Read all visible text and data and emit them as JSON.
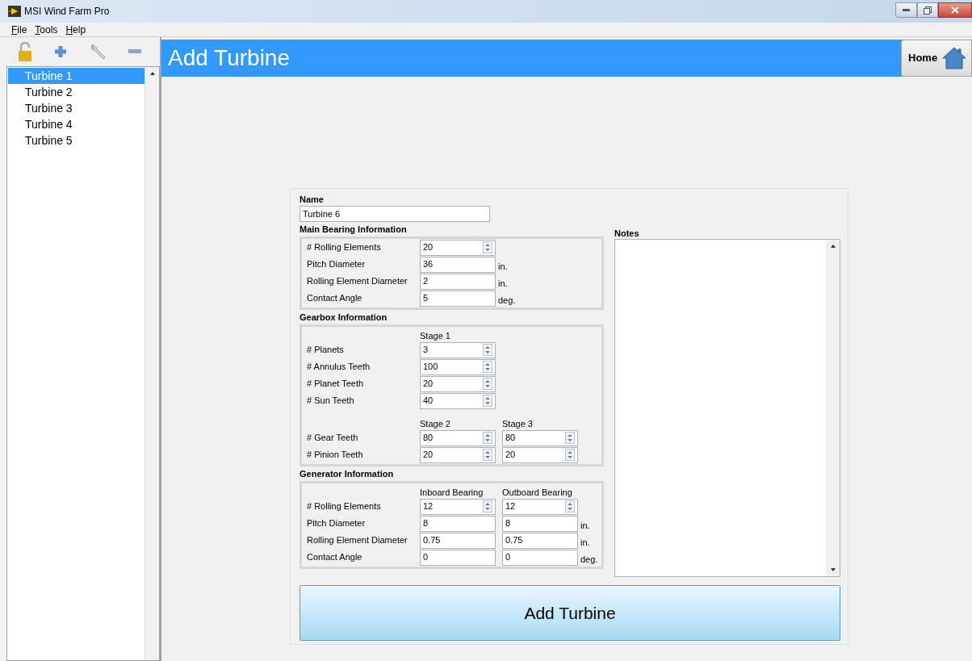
{
  "window": {
    "title": "MSI Wind Farm Pro"
  },
  "menu": [
    "File",
    "Tools",
    "Help"
  ],
  "turbines": [
    {
      "label": "Turbine 1",
      "selected": true
    },
    {
      "label": "Turbine 2",
      "selected": false
    },
    {
      "label": "Turbine 3",
      "selected": false
    },
    {
      "label": "Turbine 4",
      "selected": false
    },
    {
      "label": "Turbine 5",
      "selected": false
    }
  ],
  "header": {
    "title": "Add Turbine",
    "home_button": "Home"
  },
  "form": {
    "name_label": "Name",
    "name_value": "Turbine 6",
    "sections": [
      {
        "title": "Main Bearing Information",
        "groups": [
          {
            "rows": [
              {
                "label": "# Rolling Elements",
                "fields": [
                  {
                    "value": "20",
                    "kind": "spin"
                  }
                ]
              },
              {
                "label": "Pitch Diameter",
                "fields": [
                  {
                    "value": "36",
                    "kind": "plain"
                  }
                ],
                "unit": "in."
              },
              {
                "label": "Rolling Element Diameter",
                "fields": [
                  {
                    "value": "2",
                    "kind": "plain"
                  }
                ],
                "unit": "in."
              },
              {
                "label": "Contact Angle",
                "fields": [
                  {
                    "value": "5",
                    "kind": "plain"
                  }
                ],
                "unit": "deg."
              }
            ]
          }
        ]
      },
      {
        "title": "Gearbox Information",
        "groups": [
          {
            "columns": [
              "Stage 1"
            ],
            "rows": [
              {
                "label": "# Planets",
                "fields": [
                  {
                    "value": "3",
                    "kind": "spin"
                  }
                ]
              },
              {
                "label": "# Annulus Teeth",
                "fields": [
                  {
                    "value": "100",
                    "kind": "spin"
                  }
                ]
              },
              {
                "label": "# Planet Teeth",
                "fields": [
                  {
                    "value": "20",
                    "kind": "spin"
                  }
                ]
              },
              {
                "label": "# Sun Teeth",
                "fields": [
                  {
                    "value": "40",
                    "kind": "spin"
                  }
                ]
              }
            ]
          },
          {
            "columns": [
              "Stage 2",
              "Stage 3"
            ],
            "rows": [
              {
                "label": "# Gear Teeth",
                "fields": [
                  {
                    "value": "80",
                    "kind": "spin"
                  },
                  {
                    "value": "80",
                    "kind": "spin"
                  }
                ]
              },
              {
                "label": "# Pinion Teeth",
                "fields": [
                  {
                    "value": "20",
                    "kind": "spin"
                  },
                  {
                    "value": "20",
                    "kind": "spin"
                  }
                ]
              }
            ]
          }
        ]
      },
      {
        "title": "Generator Information",
        "groups": [
          {
            "columns": [
              "Inboard Bearing",
              "Outboard Bearing"
            ],
            "rows": [
              {
                "label": "# Rolling Elements",
                "fields": [
                  {
                    "value": "12",
                    "kind": "spin"
                  },
                  {
                    "value": "12",
                    "kind": "spin"
                  }
                ]
              },
              {
                "label": "Pitch Diameter",
                "fields": [
                  {
                    "value": "8",
                    "kind": "plain"
                  },
                  {
                    "value": "8",
                    "kind": "plain"
                  }
                ],
                "unit": "in."
              },
              {
                "label": "Rolling Element Diameter",
                "fields": [
                  {
                    "value": "0.75",
                    "kind": "plain"
                  },
                  {
                    "value": "0.75",
                    "kind": "plain"
                  }
                ],
                "unit": "in."
              },
              {
                "label": "Contact Angle",
                "fields": [
                  {
                    "value": "0",
                    "kind": "plain"
                  },
                  {
                    "value": "0",
                    "kind": "plain"
                  }
                ],
                "unit": "deg."
              }
            ]
          }
        ]
      }
    ],
    "notes_label": "Notes",
    "submit": "Add Turbine"
  }
}
